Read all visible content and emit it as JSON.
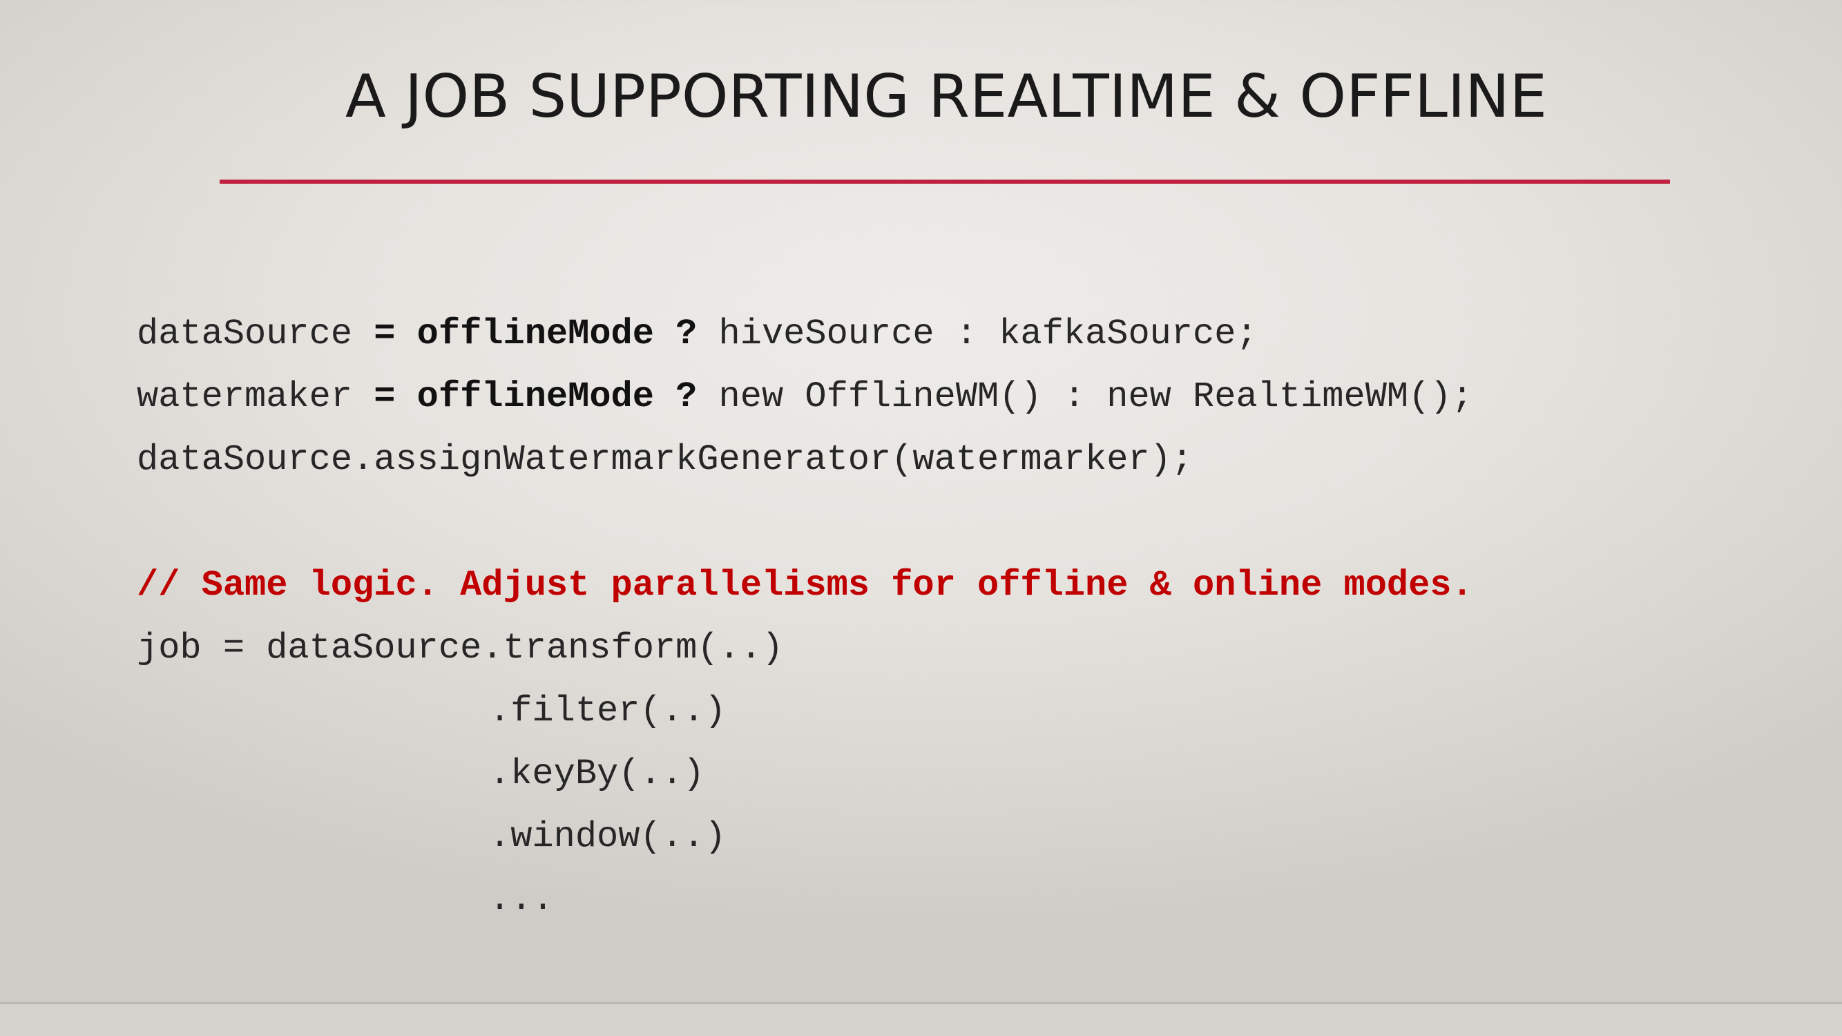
{
  "slide": {
    "title": "A JOB SUPPORTING REALTIME & OFFLINE",
    "accent_color": "#c0213f",
    "comment_color": "#c00000"
  },
  "code": {
    "line1": {
      "a": "dataSource ",
      "b": "= offlineMode ?",
      "c": " hiveSource : kafkaSource;"
    },
    "line2": {
      "a": "watermaker ",
      "b": "= offlineMode ?",
      "c": " new OfflineWM() : new RealtimeWM();"
    },
    "line3": "dataSource.assignWatermarkGenerator(watermarker);",
    "comment": "// Same logic. Adjust parallelisms for offline & online modes.",
    "job_line": "job = dataSource.transform(..)",
    "chain": [
      ".filter(..)",
      ".keyBy(..)",
      ".window(..)",
      "..."
    ]
  }
}
